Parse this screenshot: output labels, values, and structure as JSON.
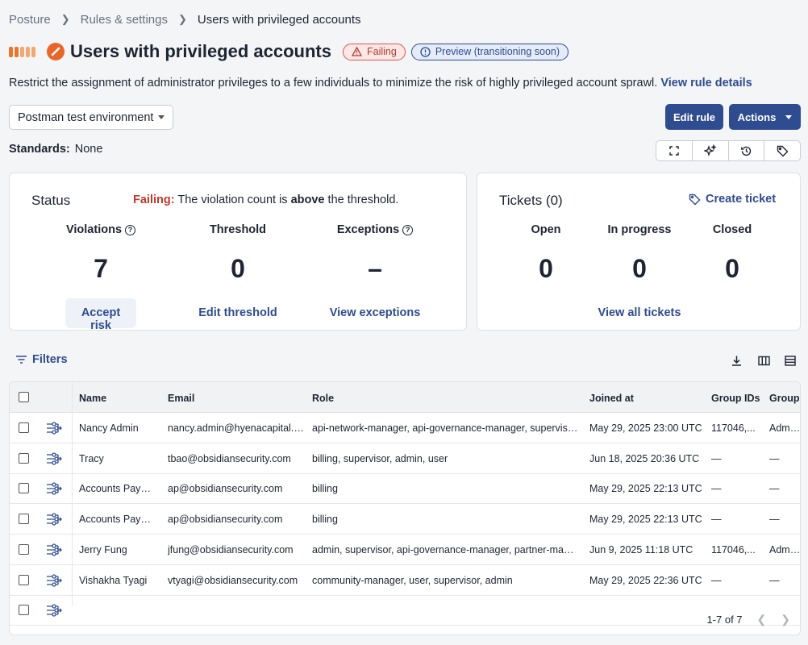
{
  "breadcrumb": [
    "Posture",
    "Rules & settings",
    "Users with privileged accounts"
  ],
  "page": {
    "title": "Users with privileged accounts",
    "failing_badge": "Failing",
    "preview_badge": "Preview (transitioning soon)",
    "description": "Restrict the assignment of administrator privileges to a few individuals to minimize the risk of highly privileged account sprawl.",
    "view_rule_details": "View rule details",
    "environment": "Postman test environment",
    "edit_rule": "Edit rule",
    "actions": "Actions",
    "standards_label": "Standards:",
    "standards_value": "None"
  },
  "status": {
    "title": "Status",
    "failing_prefix": "Failing:",
    "msg_a": "The violation count is",
    "msg_b": "above",
    "msg_c": "the threshold.",
    "violations_label": "Violations",
    "violations_value": "7",
    "threshold_label": "Threshold",
    "threshold_value": "0",
    "exceptions_label": "Exceptions",
    "exceptions_value": "–",
    "accept_risk": "Accept risk",
    "edit_threshold": "Edit threshold",
    "view_exceptions": "View exceptions"
  },
  "tickets": {
    "title": "Tickets (0)",
    "create": "Create ticket",
    "open_label": "Open",
    "open_value": "0",
    "progress_label": "In progress",
    "progress_value": "0",
    "closed_label": "Closed",
    "closed_value": "0",
    "view_all": "View all tickets"
  },
  "filters_label": "Filters",
  "table": {
    "headers": [
      "Name",
      "Email",
      "Role",
      "Joined at",
      "Group IDs",
      "Group N"
    ],
    "rows": [
      {
        "name": "Nancy Admin",
        "email": "nancy.admin@hyenacapital.net",
        "role": "api-network-manager, api-governance-manager, supervisor, ...",
        "joined": "May 29, 2025 23:00 UTC",
        "gids": "117046,...",
        "gname": "Admin ..."
      },
      {
        "name": "Tracy",
        "email": "tbao@obsidiansecurity.com",
        "role": "billing, supervisor, admin, user",
        "joined": "Jun 18, 2025 20:36 UTC",
        "gids": "—",
        "gname": "—"
      },
      {
        "name": "Accounts Payable",
        "email": "ap@obsidiansecurity.com",
        "role": "billing",
        "joined": "May 29, 2025 22:13 UTC",
        "gids": "—",
        "gname": "—"
      },
      {
        "name": "Accounts Payable",
        "email": "ap@obsidiansecurity.com",
        "role": "billing",
        "joined": "May 29, 2025 22:13 UTC",
        "gids": "—",
        "gname": "—"
      },
      {
        "name": "Jerry Fung",
        "email": "jfung@obsidiansecurity.com",
        "role": "admin, supervisor, api-governance-manager, partner-manag...",
        "joined": "Jun 9, 2025 11:18 UTC",
        "gids": "117046,...",
        "gname": "Admin ..."
      },
      {
        "name": "Vishakha Tyagi",
        "email": "vtyagi@obsidiansecurity.com",
        "role": "community-manager, user, supervisor, admin",
        "joined": "May 29, 2025 22:36 UTC",
        "gids": "—",
        "gname": "—"
      }
    ],
    "pagination": "1-7 of 7"
  },
  "colors": {
    "accent": "#2e4c8f",
    "failing": "#d9534f",
    "brand_orange": "#e8662a"
  }
}
